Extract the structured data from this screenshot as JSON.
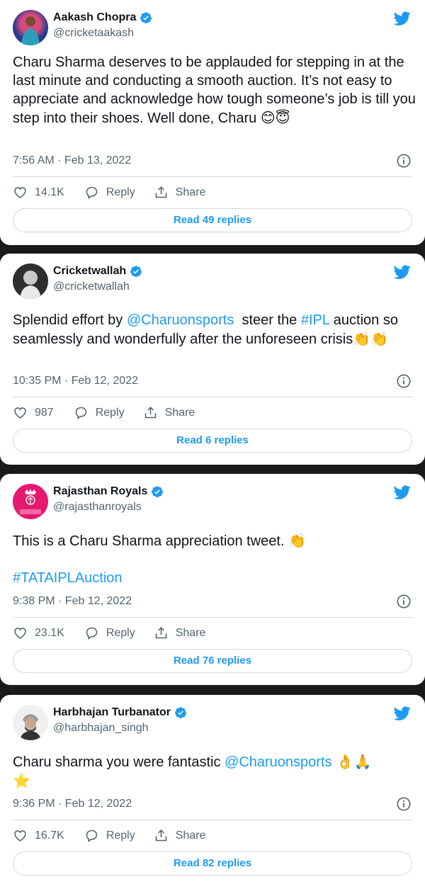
{
  "tweets": [
    {
      "name": "Aakash Chopra",
      "handle": "@cricketaakash",
      "text_parts": [
        "Charu Sharma deserves to be applauded for stepping in at the last minute and conducting a smooth auction. It’s not easy to appreciate and acknowledge how tough someone’s job is till you step into their shoes. Well done, Charu ",
        "😊😇"
      ],
      "time": "7:56 AM · Feb 13, 2022",
      "likes": "14.1K",
      "reply": "Reply",
      "share": "Share",
      "read": "Read 49 replies"
    },
    {
      "name": "Cricketwallah",
      "handle": "@cricketwallah",
      "text_a": "Splendid effort by ",
      "mention": "@Charuonsports",
      "text_b": "  steer the ",
      "hashtag": "#IPL",
      "text_c": " auction so seamlessly and wonderfully after the unforeseen crisis",
      "emoji": "👏👏",
      "time": "10:35 PM · Feb 12, 2022",
      "likes": "987",
      "reply": "Reply",
      "share": "Share",
      "read": "Read 6 replies"
    },
    {
      "name": "Rajasthan Royals",
      "handle": "@rajasthanroyals",
      "text": "This is a Charu Sharma appreciation tweet. ",
      "emoji": "👏",
      "hashtag": "#TATAIPLAuction",
      "logo_text": "RAJASTHAN ROYALS",
      "time": "9:38 PM · Feb 12, 2022",
      "likes": "23.1K",
      "reply": "Reply",
      "share": "Share",
      "read": "Read 76 replies"
    },
    {
      "name": "Harbhajan Turbanator",
      "handle": "@harbhajan_singh",
      "text": "Charu sharma you were fantastic ",
      "mention": "@Charuonsports",
      "emoji": " 👌🙏",
      "emoji2": "⭐",
      "time": "9:36 PM · Feb 12, 2022",
      "likes": "16.7K",
      "reply": "Reply",
      "share": "Share",
      "read": "Read 82 replies"
    }
  ],
  "colors": {
    "link": "#1d9bf0",
    "muted": "#536471",
    "background": "#1a1a1a"
  }
}
